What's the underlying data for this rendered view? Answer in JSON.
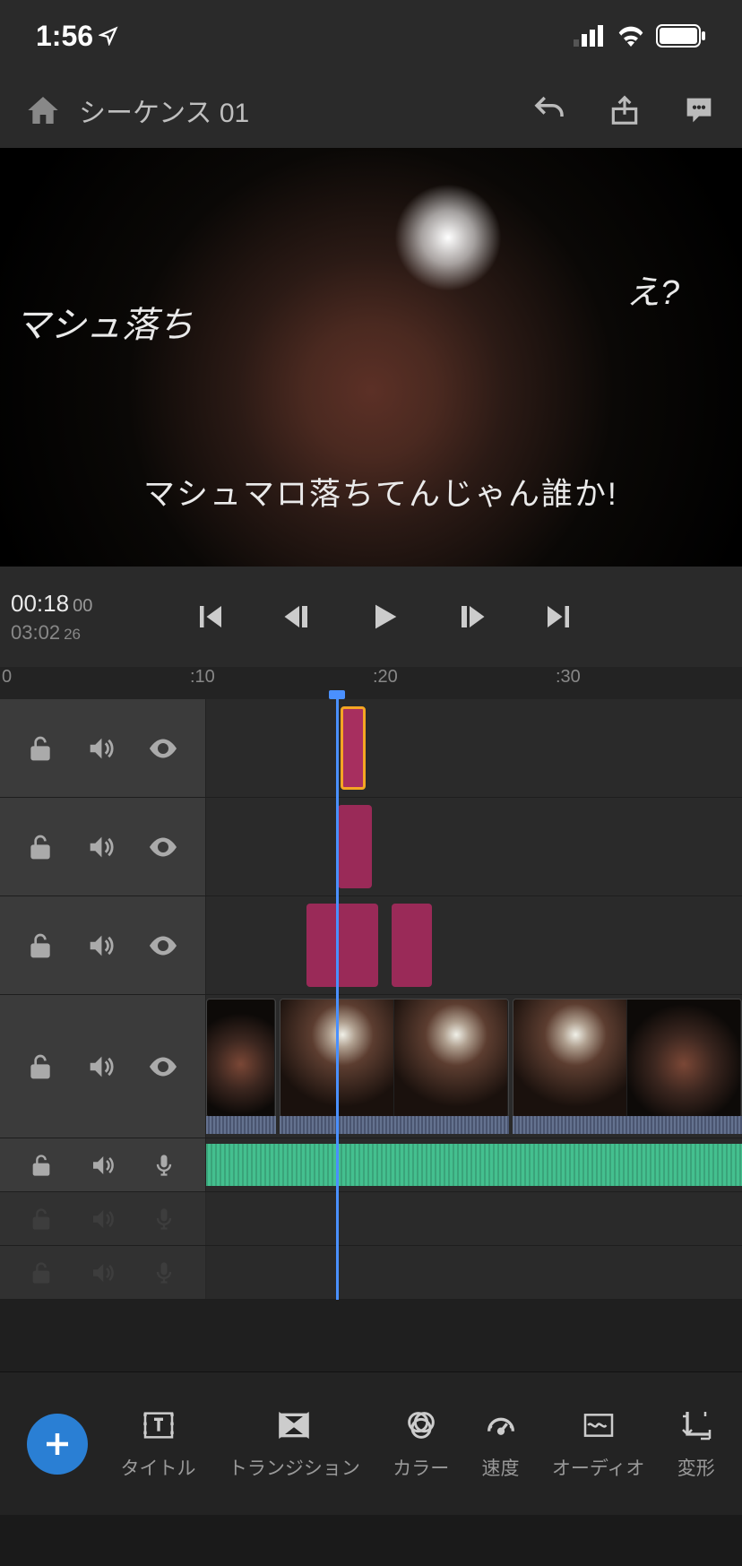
{
  "status": {
    "time": "1:56"
  },
  "header": {
    "title": "シーケンス 01"
  },
  "preview": {
    "caption1": "マシュ落ち",
    "caption2": "え?",
    "caption3": "マシュマロ落ちてんじゃん誰か!"
  },
  "transport": {
    "current": "00:18",
    "current_frames": "00",
    "total": "03:02",
    "total_frames": "26"
  },
  "ruler": {
    "m0": "0",
    "m10": ":10",
    "m20": ":20",
    "m30": ":30"
  },
  "toolbar": {
    "title": "タイトル",
    "transition": "トランジション",
    "color": "カラー",
    "speed": "速度",
    "audio": "オーディオ",
    "transform": "変形"
  },
  "timeline": {
    "playhead_tick": 18,
    "tracks": [
      {
        "type": "overlay",
        "clips": [
          {
            "start": 17.8,
            "end": 19.4,
            "selected": true
          }
        ]
      },
      {
        "type": "overlay",
        "clips": [
          {
            "start": 18.2,
            "end": 20.3
          }
        ]
      },
      {
        "type": "overlay",
        "clips": [
          {
            "start": 15.4,
            "end": 19.6
          },
          {
            "start": 20.5,
            "end": 22.8
          }
        ]
      },
      {
        "type": "video",
        "clips": [
          {
            "start": 9.5,
            "end": 14.4,
            "bright": false
          },
          {
            "start": 14.6,
            "end": 27.5,
            "bright": true
          },
          {
            "start": 27.7,
            "end": 36.5,
            "bright": true
          }
        ]
      },
      {
        "type": "audio_main",
        "wave": true
      },
      {
        "type": "audio_empty"
      },
      {
        "type": "audio_empty"
      }
    ]
  }
}
